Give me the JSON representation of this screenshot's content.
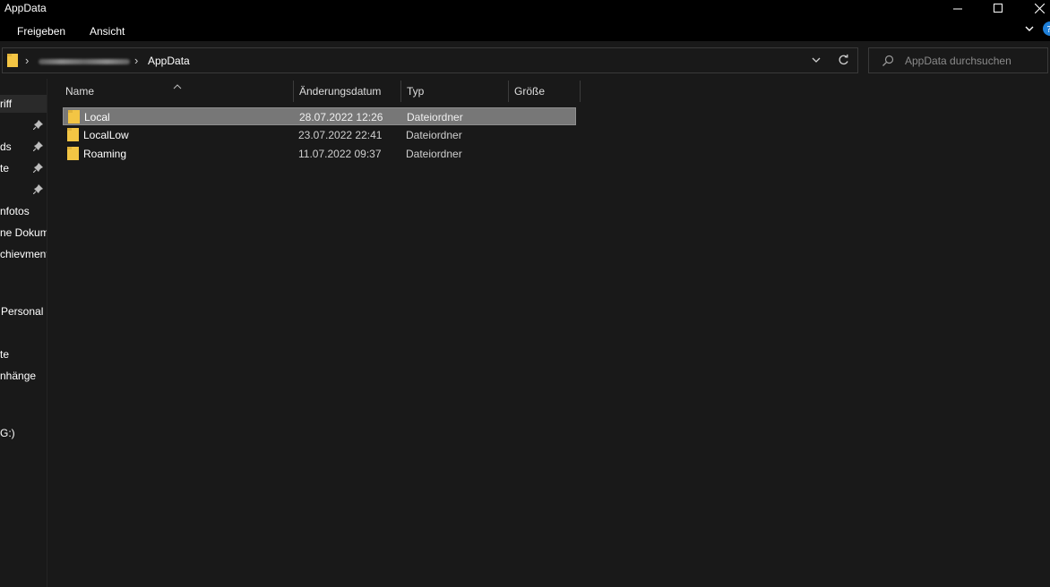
{
  "window": {
    "title": "AppData"
  },
  "ribbon": {
    "tabs": [
      "Freigeben",
      "Ansicht"
    ]
  },
  "address": {
    "current": "AppData",
    "search_placeholder": "AppData durchsuchen"
  },
  "nav": {
    "items": [
      {
        "label": "riff",
        "pinned": false,
        "selected": true
      },
      {
        "label": "",
        "pinned": true
      },
      {
        "label": "ds",
        "pinned": true
      },
      {
        "label": "te",
        "pinned": true
      },
      {
        "label": "",
        "pinned": true
      },
      {
        "label": "nfotos",
        "pinned": false
      },
      {
        "label": "ne Dokum",
        "pinned": false
      },
      {
        "label": "chievment",
        "pinned": false
      },
      {
        "label": "Personal",
        "pinned": false
      },
      {
        "label": "te",
        "pinned": false
      },
      {
        "label": "nhänge",
        "pinned": false
      },
      {
        "label": "G:)",
        "pinned": false
      }
    ]
  },
  "table": {
    "columns": {
      "name": "Name",
      "date": "Änderungsdatum",
      "type": "Typ",
      "size": "Größe"
    },
    "rows": [
      {
        "name": "Local",
        "date": "28.07.2022 12:26",
        "type": "Dateiordner",
        "size": "",
        "selected": true
      },
      {
        "name": "LocalLow",
        "date": "23.07.2022 22:41",
        "type": "Dateiordner",
        "size": "",
        "selected": false
      },
      {
        "name": "Roaming",
        "date": "11.07.2022 09:37",
        "type": "Dateiordner",
        "size": "",
        "selected": false
      }
    ]
  },
  "colors": {
    "background": "#191919",
    "titlebar": "#000000",
    "selection": "#777777",
    "folder": "#f3c544",
    "help_accent": "#1e7fd9"
  },
  "icons": {
    "folder": "folder-icon",
    "pin": "pin-icon",
    "search": "search-icon",
    "refresh": "refresh-icon",
    "help": "help-icon"
  }
}
